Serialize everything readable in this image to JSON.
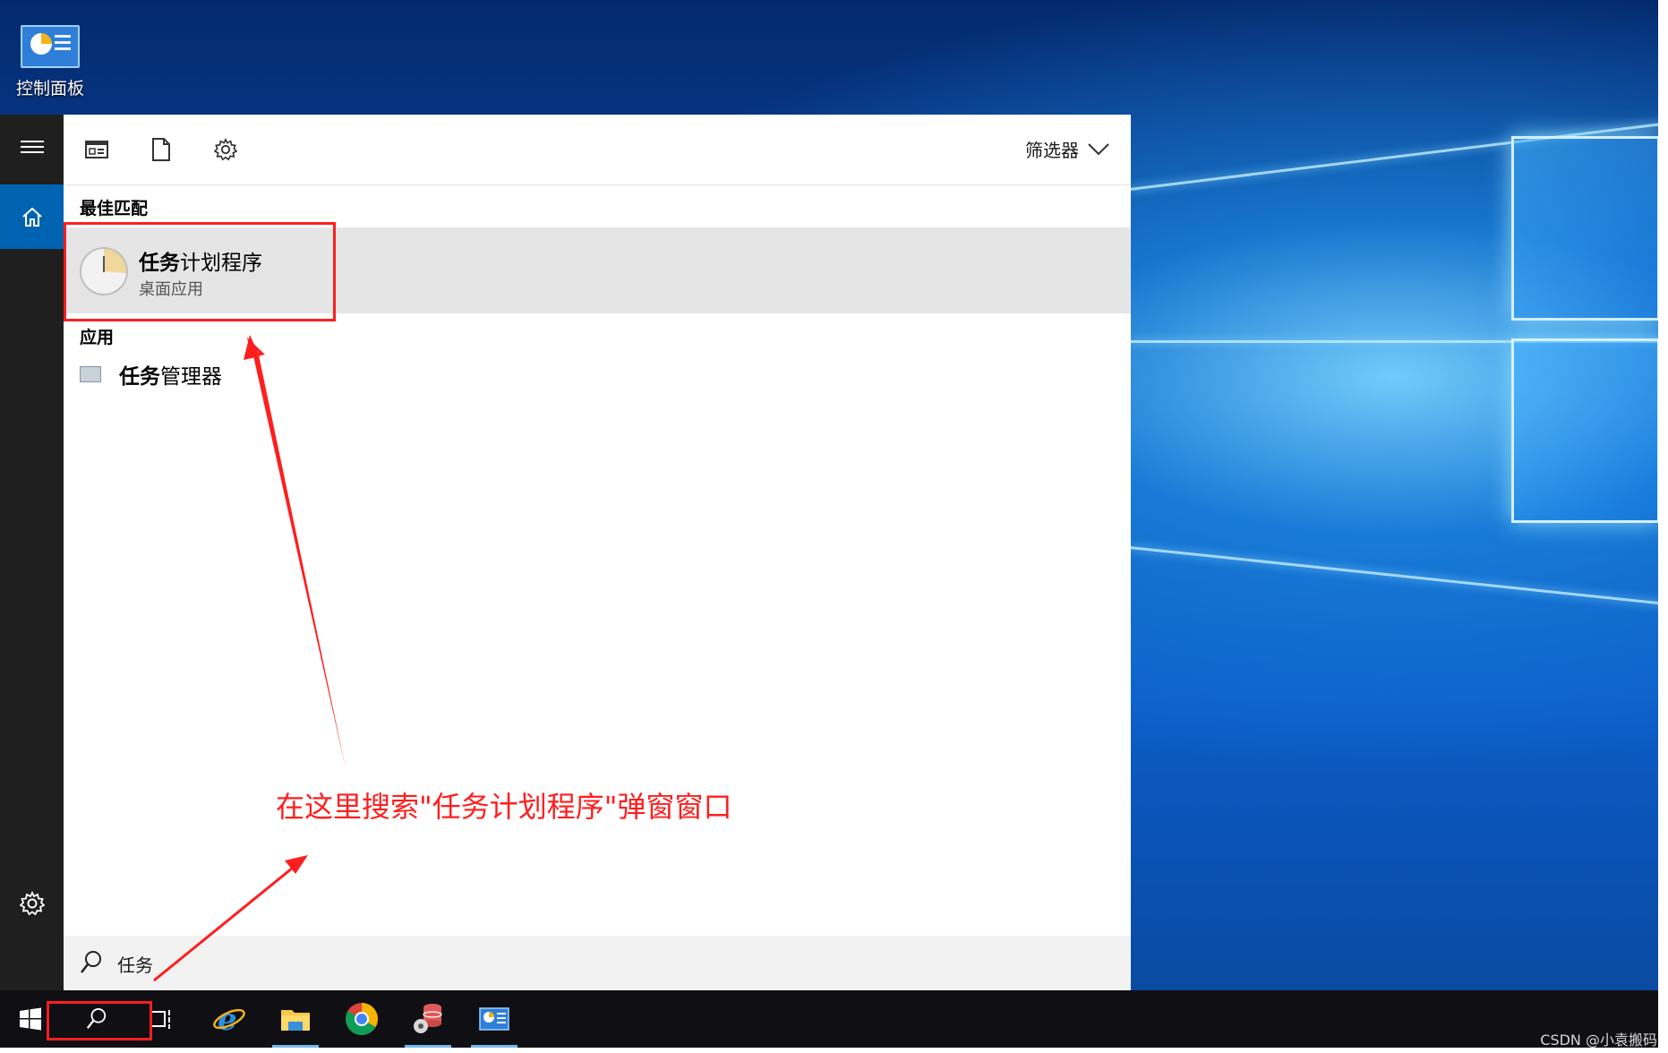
{
  "desktop": {
    "icons": [
      {
        "label": "控制面板",
        "icon": "control-panel-icon"
      }
    ]
  },
  "rail": {
    "items": [
      {
        "icon": "hamburger-menu-icon"
      },
      {
        "icon": "home-icon",
        "selected": true
      },
      {
        "icon": "gear-icon"
      }
    ],
    "colors": {
      "background": "#1f1f1f",
      "selected": "#0063b1"
    }
  },
  "search_panel": {
    "toolbar": {
      "icons": [
        "apps-scope-icon",
        "documents-scope-icon",
        "settings-scope-icon"
      ],
      "filter_label": "筛选器"
    },
    "best_match": {
      "title": "最佳匹配",
      "item": {
        "name_bold": "任务",
        "name_rest": "计划程序",
        "subtitle": "桌面应用",
        "icon": "task-scheduler-icon"
      }
    },
    "apps": {
      "title": "应用",
      "items": [
        {
          "name_bold": "任务",
          "name_rest": "管理器",
          "icon": "task-manager-icon"
        }
      ]
    },
    "search": {
      "query": "任务",
      "icon": "search-icon"
    }
  },
  "taskbar": {
    "items": [
      {
        "name": "start-button",
        "icon": "windows-logo-icon"
      },
      {
        "name": "search-button",
        "icon": "search-icon"
      },
      {
        "name": "task-view-button",
        "icon": "task-view-icon"
      },
      {
        "name": "internet-explorer",
        "icon": "ie-icon",
        "running": false
      },
      {
        "name": "file-explorer",
        "icon": "folder-icon",
        "running": true
      },
      {
        "name": "chrome",
        "icon": "chrome-icon",
        "running": false
      },
      {
        "name": "db-tool",
        "icon": "database-gear-icon",
        "running": true
      },
      {
        "name": "control-panel",
        "icon": "control-panel-icon",
        "running": true
      }
    ]
  },
  "annotation": {
    "text": "在这里搜索\"任务计划程序\"弹窗窗口",
    "color": "#ff1e1e"
  },
  "watermark": "CSDN @小袁搬码"
}
